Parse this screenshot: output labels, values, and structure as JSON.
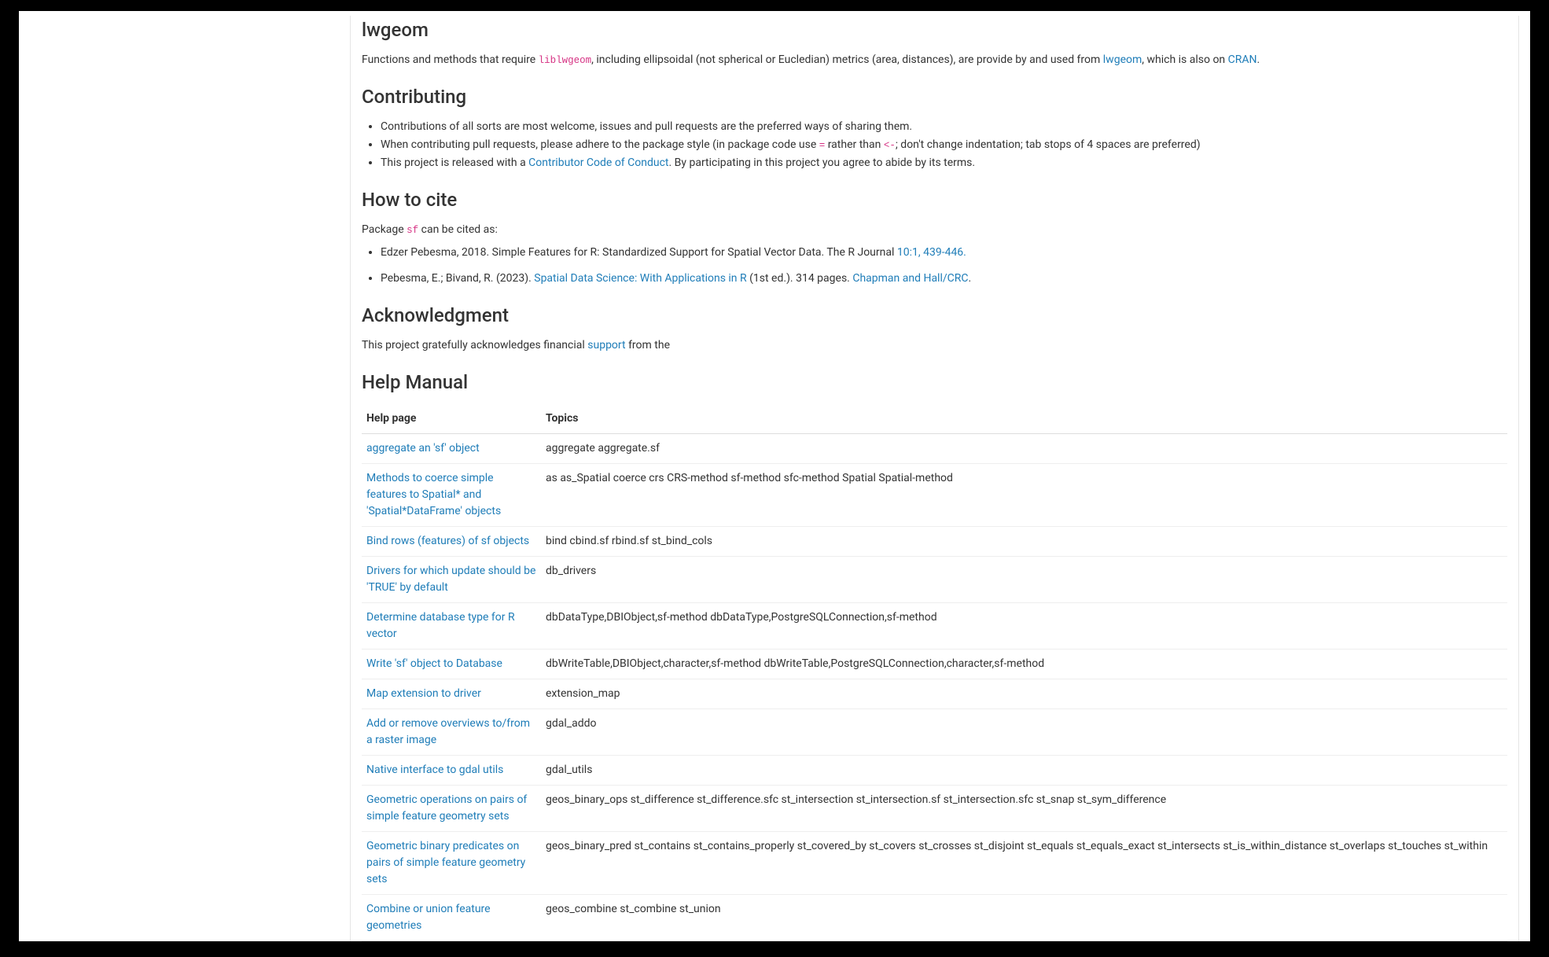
{
  "sections": {
    "lwgeom": {
      "title": "lwgeom",
      "text1": "Functions and methods that require ",
      "code1": "liblwgeom",
      "text2": ", including ellipsoidal (not spherical or Eucledian) metrics (area, distances), are provide by and used from ",
      "link_lwgeom": "lwgeom",
      "text3": ", which is also on ",
      "link_cran": "CRAN",
      "text4": "."
    },
    "contributing": {
      "title": "Contributing",
      "item1": "Contributions of all sorts are most welcome, issues and pull requests are the preferred ways of sharing them.",
      "item2a": "When contributing pull requests, please adhere to the package style (in package code use ",
      "item2code1": "=",
      "item2b": " rather than ",
      "item2code2": "<-",
      "item2c": "; don't change indentation; tab stops of 4 spaces are preferred)",
      "item3a": "This project is released with a ",
      "item3link": "Contributor Code of Conduct",
      "item3b": ". By participating in this project you agree to abide by its terms."
    },
    "howtocite": {
      "title": "How to cite",
      "intro1": "Package ",
      "introcode": "sf",
      "intro2": " can be cited as:",
      "cite1a": "Edzer Pebesma, 2018. Simple Features for R: Standardized Support for Spatial Vector Data. The R Journal ",
      "cite1link": "10:1, 439-446.",
      "cite2a": "Pebesma, E.; Bivand, R. (2023). ",
      "cite2link1": "Spatial Data Science: With Applications in R",
      "cite2b": " (1st ed.). 314 pages. ",
      "cite2link2": "Chapman and Hall/CRC",
      "cite2c": "."
    },
    "ack": {
      "title": "Acknowledgment",
      "text1": "This project gratefully acknowledges financial ",
      "link": "support",
      "text2": " from the"
    },
    "manual": {
      "title": "Help Manual",
      "col1": "Help page",
      "col2": "Topics",
      "rows": [
        {
          "help": "aggregate an 'sf' object",
          "topics": "aggregate aggregate.sf"
        },
        {
          "help": "Methods to coerce simple features to Spatial* and 'Spatial*DataFrame' objects",
          "topics": "as as_Spatial coerce crs CRS-method sf-method sfc-method Spatial Spatial-method"
        },
        {
          "help": "Bind rows (features) of sf objects",
          "topics": "bind cbind.sf rbind.sf st_bind_cols"
        },
        {
          "help": "Drivers for which update should be 'TRUE' by default",
          "topics": "db_drivers"
        },
        {
          "help": "Determine database type for R vector",
          "topics": "dbDataType,DBIObject,sf-method dbDataType,PostgreSQLConnection,sf-method"
        },
        {
          "help": "Write 'sf' object to Database",
          "topics": "dbWriteTable,DBIObject,character,sf-method dbWriteTable,PostgreSQLConnection,character,sf-method"
        },
        {
          "help": "Map extension to driver",
          "topics": "extension_map"
        },
        {
          "help": "Add or remove overviews to/from a raster image",
          "topics": "gdal_addo"
        },
        {
          "help": "Native interface to gdal utils",
          "topics": "gdal_utils"
        },
        {
          "help": "Geometric operations on pairs of simple feature geometry sets",
          "topics": "geos_binary_ops st_difference st_difference.sfc st_intersection st_intersection.sf st_intersection.sfc st_snap st_sym_difference"
        },
        {
          "help": "Geometric binary predicates on pairs of simple feature geometry sets",
          "topics": "geos_binary_pred st_contains st_contains_properly st_covered_by st_covers st_crosses st_disjoint st_equals st_equals_exact st_intersects st_is_within_distance st_overlaps st_touches st_within"
        },
        {
          "help": "Combine or union feature geometries",
          "topics": "geos_combine st_combine st_union"
        }
      ]
    }
  }
}
